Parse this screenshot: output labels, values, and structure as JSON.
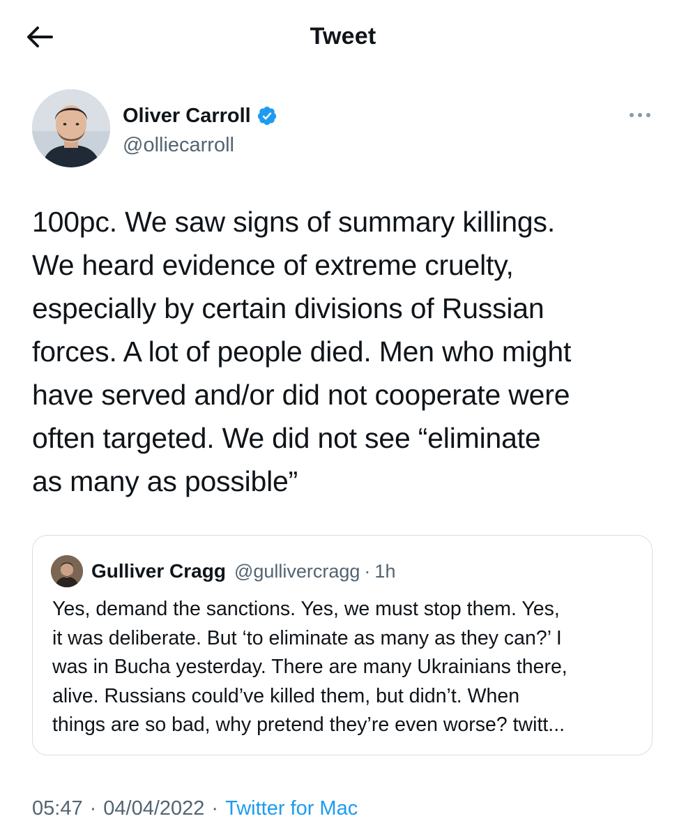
{
  "header": {
    "title": "Tweet",
    "back_icon": "arrow-left-icon"
  },
  "author": {
    "name": "Oliver Carroll",
    "handle": "@olliecarroll",
    "verified": true,
    "verified_icon": "verified-badge-icon",
    "more_icon": "more-horizontal-icon"
  },
  "tweet": {
    "text": "100pc. We saw signs of summary killings.\nWe heard evidence of extreme cruelty,\nespecially by certain divisions of Russian\nforces. A lot of people died. Men who might\nhave served and/or did not cooperate were\noften targeted. We did not see “eliminate\nas many as possible”"
  },
  "quote": {
    "name": "Gulliver Cragg",
    "handle": "@gullivercragg",
    "separator": "·",
    "time": "1h",
    "text": "Yes, demand the sanctions. Yes, we must stop them. Yes,\nit was deliberate. But ‘to eliminate as many as they can?’ I\nwas in Bucha yesterday. There are many Ukrainians there,\nalive. Russians could’ve killed them, but didn’t. When\nthings are so bad, why pretend they’re even worse? twitt..."
  },
  "meta": {
    "time": "05:47",
    "dot1": "·",
    "date": "04/04/2022",
    "dot2": "·",
    "source": "Twitter for Mac"
  },
  "colors": {
    "text": "#0f1419",
    "muted": "#536471",
    "accent": "#1d9bf0",
    "border": "#d7dde2"
  }
}
